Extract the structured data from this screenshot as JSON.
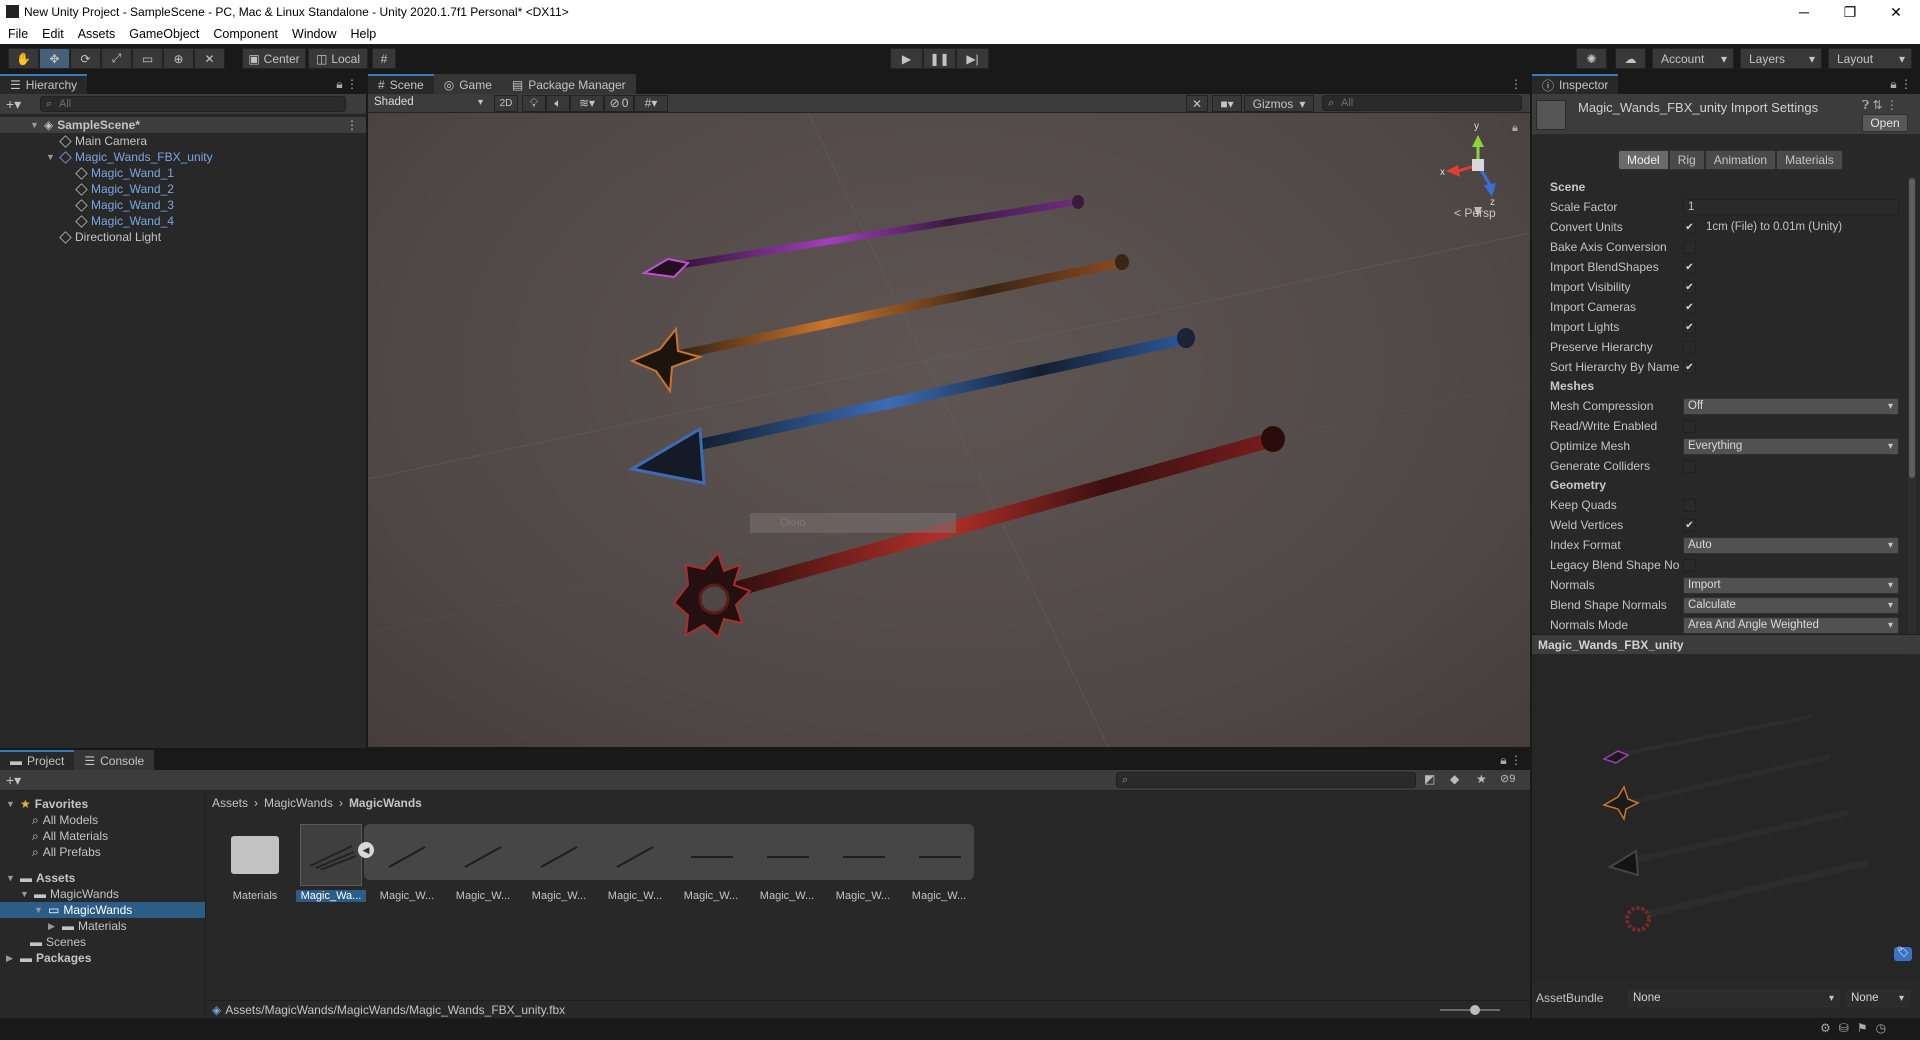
{
  "window": {
    "title": "New Unity Project - SampleScene - PC, Mac & Linux Standalone - Unity 2020.1.7f1 Personal* <DX11>"
  },
  "menu": [
    "File",
    "Edit",
    "Assets",
    "GameObject",
    "Component",
    "Window",
    "Help"
  ],
  "toolbar": {
    "center_label": "Center",
    "local_label": "Local",
    "account_label": "Account",
    "layers_label": "Layers",
    "layout_label": "Layout"
  },
  "hierarchy": {
    "tab": "Hierarchy",
    "search_placeholder": "All",
    "scene": "SampleScene*",
    "items": [
      "Main Camera",
      "Magic_Wands_FBX_unity",
      "Magic_Wand_1",
      "Magic_Wand_2",
      "Magic_Wand_3",
      "Magic_Wand_4",
      "Directional Light"
    ]
  },
  "scene_view": {
    "tabs": [
      "Scene",
      "Game",
      "Package Manager"
    ],
    "shading": "Shaded",
    "mode_2d": "2D",
    "hidden_count": "0",
    "gizmos": "Gizmos",
    "search_placeholder": "All",
    "persp": "< Persp",
    "tooltip": "Окно",
    "axis": {
      "x": "x",
      "y": "y",
      "z": "z"
    }
  },
  "inspector": {
    "tab": "Inspector",
    "title": "Magic_Wands_FBX_unity Import Settings",
    "open_label": "Open",
    "tabs": [
      "Model",
      "Rig",
      "Animation",
      "Materials"
    ],
    "section_scene": "Scene",
    "scale_factor_label": "Scale Factor",
    "scale_factor": "1",
    "convert_units_label": "Convert Units",
    "convert_units_note": "1cm (File) to 0.01m (Unity)",
    "scene_rows": [
      {
        "label": "Bake Axis Conversion",
        "checked": false
      },
      {
        "label": "Import BlendShapes",
        "checked": true
      },
      {
        "label": "Import Visibility",
        "checked": true
      },
      {
        "label": "Import Cameras",
        "checked": true
      },
      {
        "label": "Import Lights",
        "checked": true
      },
      {
        "label": "Preserve Hierarchy",
        "checked": false
      },
      {
        "label": "Sort Hierarchy By Name",
        "checked": true
      }
    ],
    "section_meshes": "Meshes",
    "mesh_compression_label": "Mesh Compression",
    "mesh_compression": "Off",
    "rw_label": "Read/Write Enabled",
    "optimize_label": "Optimize Mesh",
    "optimize": "Everything",
    "colliders_label": "Generate Colliders",
    "section_geometry": "Geometry",
    "keep_quads_label": "Keep Quads",
    "weld_label": "Weld Vertices",
    "index_label": "Index Format",
    "index": "Auto",
    "legacy_label": "Legacy Blend Shape No",
    "normals_label": "Normals",
    "normals": "Import",
    "blend_normals_label": "Blend Shape Normals",
    "blend_normals": "Calculate",
    "normals_mode_label": "Normals Mode",
    "normals_mode": "Area And Angle Weighted",
    "preview_title": "Magic_Wands_FBX_unity",
    "assetbundle_label": "AssetBundle",
    "assetbundle": "None",
    "assetbundle_variant": "None"
  },
  "project": {
    "tabs": [
      "Project",
      "Console"
    ],
    "hidden_count": "9",
    "favorites": "Favorites",
    "fav_items": [
      "All Models",
      "All Materials",
      "All Prefabs"
    ],
    "assets": "Assets",
    "tree": [
      "MagicWands",
      "MagicWands",
      "Materials",
      "Scenes"
    ],
    "packages": "Packages",
    "breadcrumb": [
      "Assets",
      "MagicWands",
      "MagicWands"
    ],
    "items": [
      {
        "name": "Materials"
      },
      {
        "name": "Magic_Wa..."
      },
      {
        "name": "Magic_W..."
      },
      {
        "name": "Magic_W..."
      },
      {
        "name": "Magic_W..."
      },
      {
        "name": "Magic_W..."
      },
      {
        "name": "Magic_W..."
      },
      {
        "name": "Magic_W..."
      },
      {
        "name": "Magic_W..."
      },
      {
        "name": "Magic_W..."
      }
    ],
    "path": "Assets/MagicWands/MagicWands/Magic_Wands_FBX_unity.fbx"
  },
  "colors": {
    "accent": "#3a79bb",
    "selection": "#2c5d87",
    "panel": "#282828",
    "blue_text": "#7ba7e6"
  }
}
